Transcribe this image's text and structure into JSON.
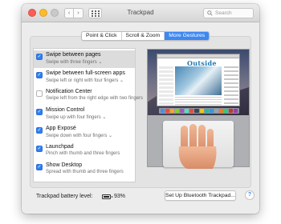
{
  "window": {
    "title": "Trackpad"
  },
  "toolbar": {
    "back_glyph": "‹",
    "forward_glyph": "›",
    "search_placeholder": "Search"
  },
  "tabs": [
    {
      "label": "Point & Click",
      "active": false
    },
    {
      "label": "Scroll & Zoom",
      "active": false
    },
    {
      "label": "More Gestures",
      "active": true
    }
  ],
  "gestures": [
    {
      "title": "Swipe between pages",
      "subtitle": "Swipe with three fingers ⌄",
      "checked": true,
      "selected": true
    },
    {
      "title": "Swipe between full-screen apps",
      "subtitle": "Swipe left or right with four fingers ⌄",
      "checked": true,
      "selected": false
    },
    {
      "title": "Notification Center",
      "subtitle": "Swipe left from the right edge with two fingers",
      "checked": false,
      "selected": false
    },
    {
      "title": "Mission Control",
      "subtitle": "Swipe up with four fingers ⌄",
      "checked": true,
      "selected": false
    },
    {
      "title": "App Exposé",
      "subtitle": "Swipe down with four fingers ⌄",
      "checked": true,
      "selected": false
    },
    {
      "title": "Launchpad",
      "subtitle": "Pinch with thumb and three fingers",
      "checked": true,
      "selected": false
    },
    {
      "title": "Show Desktop",
      "subtitle": "Spread with thumb and three fingers",
      "checked": true,
      "selected": false
    }
  ],
  "preview": {
    "site_logo": "Outside"
  },
  "footer": {
    "battery_label": "Trackpad battery level:",
    "battery_percent": "93%",
    "battery_level": 0.93,
    "bluetooth_button": "Set Up Bluetooth Trackpad...",
    "help_glyph": "?"
  },
  "colors": {
    "accent": "#3d88f2",
    "close": "#fc5f57",
    "minimize": "#fdbc2e"
  }
}
